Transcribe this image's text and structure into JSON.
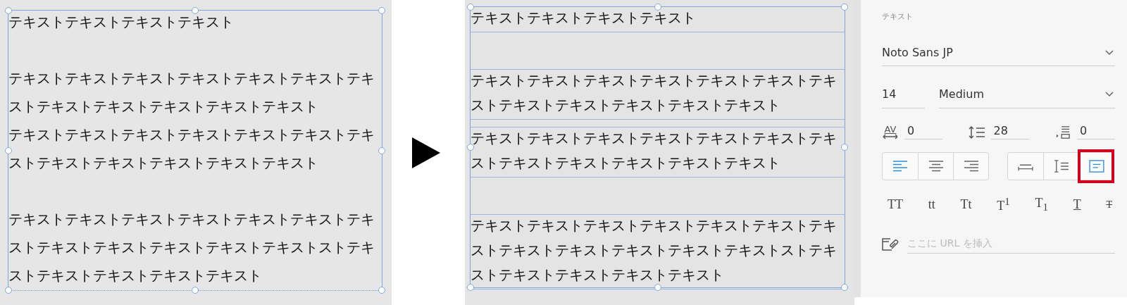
{
  "before": {
    "lines": [
      {
        "kind": "text",
        "text": "テキストテキストテキストテキスト"
      },
      {
        "kind": "blank"
      },
      {
        "kind": "text",
        "text": "テキストテキストテキストテキストテキストテキストテキ"
      },
      {
        "kind": "text",
        "text": "ストテキストテキストテキストテキストテキスト"
      },
      {
        "kind": "text",
        "text": "テキストテキストテキストテキストテキストテキストテキ"
      },
      {
        "kind": "text",
        "text": "ストテキストテキストテキストテキストテキスト"
      },
      {
        "kind": "blank"
      },
      {
        "kind": "text",
        "text": "テキストテキストテキストテキストテキストテキストテキ"
      },
      {
        "kind": "text",
        "text": "ストテキストテキストテキストテキストテキストストテキ"
      },
      {
        "kind": "text",
        "text": "ストテキストテキストテキストテキスト"
      }
    ]
  },
  "after": {
    "blocks": [
      {
        "kind": "paragraph",
        "lines": [
          "テキストテキストテキストテキスト"
        ]
      },
      {
        "kind": "spacer"
      },
      {
        "kind": "paragraph",
        "lines": [
          "テキストテキストテキストテキストテキストテキストテキ",
          "ストテキストテキストテキストテキストテキスト"
        ]
      },
      {
        "kind": "paragraph",
        "lines": [
          "テキストテキストテキストテキストテキストテキストテキ",
          "ストテキストテキストテキストテキストテキスト"
        ]
      },
      {
        "kind": "spacer"
      },
      {
        "kind": "paragraph",
        "lines": [
          "テキストテキストテキストテキストテキストテキストテキ",
          "ストテキストテキストテキストテキストテキストストテキ",
          "ストテキストテキストテキストテキスト"
        ]
      }
    ]
  },
  "panel": {
    "title": "テキスト",
    "font_family": "Noto Sans JP",
    "font_size": "14",
    "font_weight": "Medium",
    "spacing": [
      {
        "kind": "tracking",
        "label": "AV",
        "value": "0"
      },
      {
        "kind": "line",
        "value": "28"
      },
      {
        "kind": "paragraph",
        "value": "0"
      }
    ],
    "alignment": [
      {
        "kind": "left",
        "selected": true
      },
      {
        "kind": "center",
        "selected": false
      },
      {
        "kind": "right",
        "selected": false
      }
    ],
    "box_modes": [
      {
        "kind": "auto-width",
        "selected": false,
        "highlighted": false
      },
      {
        "kind": "auto-height",
        "selected": false,
        "highlighted": false
      },
      {
        "kind": "fixed",
        "selected": true,
        "highlighted": true
      }
    ],
    "styles": [
      {
        "kind": "plain",
        "label": "TT"
      },
      {
        "kind": "plain",
        "label": "tt"
      },
      {
        "kind": "plain",
        "label": "Tt"
      },
      {
        "kind": "plain",
        "label": "T$^{1}$"
      },
      {
        "kind": "plain",
        "label": "T$_{1}$"
      },
      {
        "kind": "underline",
        "label": "T"
      },
      {
        "kind": "strike",
        "label": "T"
      }
    ],
    "link": {
      "placeholder": "ここに URL を挿入"
    }
  }
}
